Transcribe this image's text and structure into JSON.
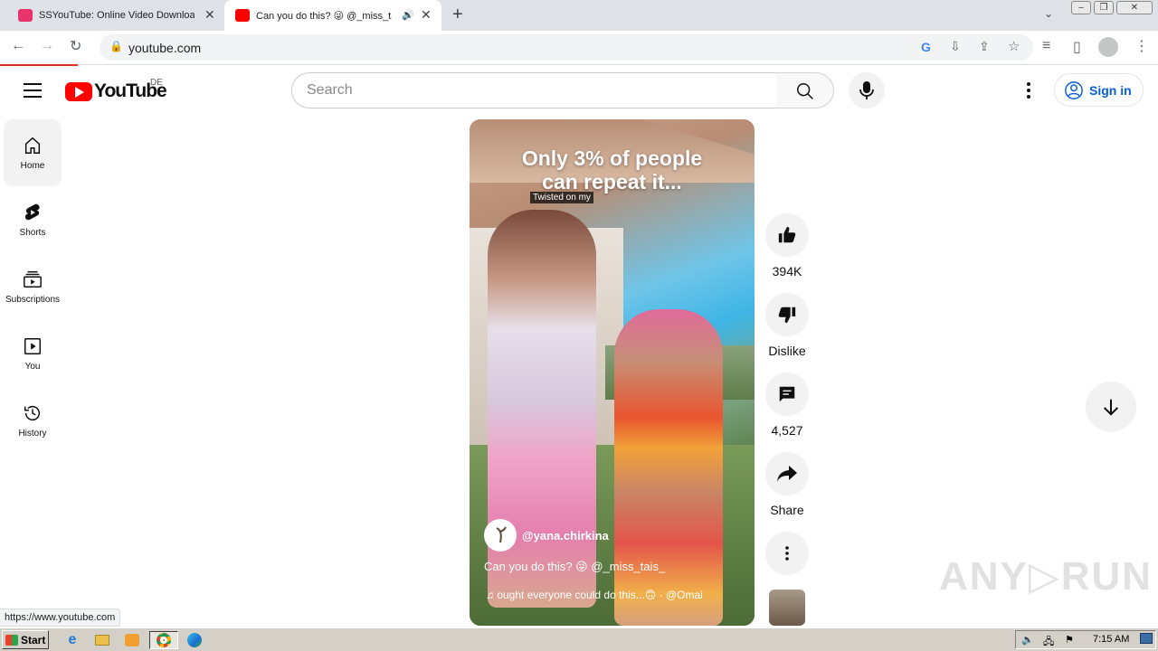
{
  "browser": {
    "tabs": [
      {
        "title": "SSYouTube: Online Video Downloade",
        "favicon_color": "#e8336d"
      },
      {
        "title": "Can you do this? 😜 @_miss_tai",
        "favicon_color": "#ff0000",
        "active": true
      }
    ],
    "url": "youtube.com",
    "status_url": "https://www.youtube.com"
  },
  "header": {
    "logo_text": "YouTube",
    "country_code": "DE",
    "search_placeholder": "Search",
    "signin_label": "Sign in"
  },
  "guide": {
    "items": [
      {
        "label": "Home",
        "icon": "home-icon",
        "active": true
      },
      {
        "label": "Shorts",
        "icon": "shorts-icon"
      },
      {
        "label": "Subscriptions",
        "icon": "subscriptions-icon"
      },
      {
        "label": "You",
        "icon": "you-icon"
      },
      {
        "label": "History",
        "icon": "history-icon"
      }
    ]
  },
  "short": {
    "overlay_line1": "Only 3% of people",
    "overlay_line2": "can repeat it...",
    "caption_chip": "Twisted on my",
    "channel": "@yana.chirkina",
    "title": "Can you do this? 😜 @_miss_tais_",
    "music": "♫ ought everyone could do this...🙃 · @Omai"
  },
  "actions": {
    "like_count": "394K",
    "dislike_label": "Dislike",
    "comment_count": "4,527",
    "share_label": "Share"
  },
  "watermark": "ANY▷RUN",
  "taskbar": {
    "start_label": "Start",
    "clock": "7:15 AM"
  },
  "colors": {
    "accent_blue": "#065fd4",
    "youtube_red": "#ff0000",
    "chip_gray": "#f2f2f2"
  }
}
